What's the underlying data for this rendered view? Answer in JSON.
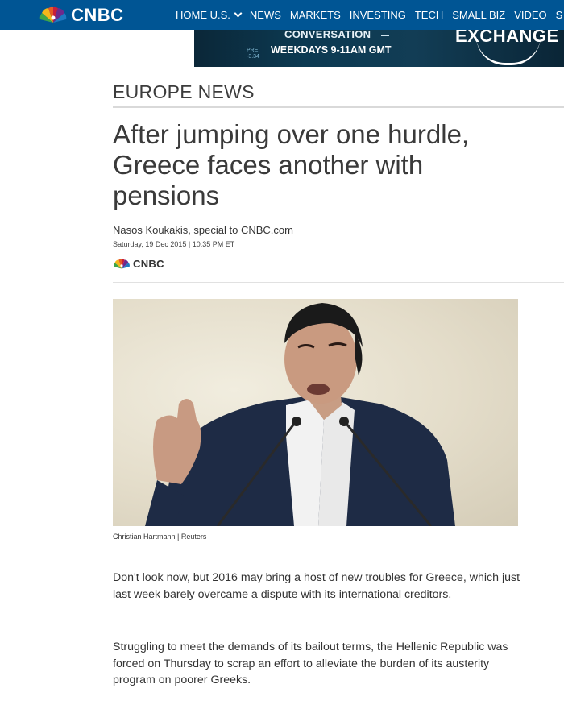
{
  "brand": {
    "logo_text": "CNBC"
  },
  "nav": {
    "items": [
      {
        "label": "HOME U.S.",
        "has_dropdown": true
      },
      {
        "label": "NEWS"
      },
      {
        "label": "MARKETS"
      },
      {
        "label": "INVESTING"
      },
      {
        "label": "TECH"
      },
      {
        "label": "SMALL BIZ"
      },
      {
        "label": "VIDEO"
      },
      {
        "label": "S"
      }
    ],
    "bg_color": "#005594"
  },
  "ad": {
    "line1": "CONVERSATION",
    "line2": "WEEKDAYS 9-11AM GMT",
    "brand_text": "EXCHANGE",
    "ticker": [
      "PRE",
      "-3.34"
    ]
  },
  "section": {
    "label": "EUROPE NEWS"
  },
  "article": {
    "headline": "After jumping over one hurdle, Greece faces another with pensions",
    "byline": "Nasos Koukakis, special to CNBC.com",
    "dateline": "Saturday, 19 Dec 2015 | 10:35 PM ET",
    "source_logo_text": "CNBC",
    "image": {
      "caption": "Christian Hartmann | Reuters"
    },
    "paragraphs": [
      "Don't look now, but 2016 may bring a host of new troubles for Greece, which just last week barely overcame a dispute with its international creditors.",
      "Struggling to meet the demands of its bailout terms, the Hellenic Republic was forced on Thursday to scrap an effort to alleviate the burden of its austerity program on poorer Greeks."
    ]
  }
}
